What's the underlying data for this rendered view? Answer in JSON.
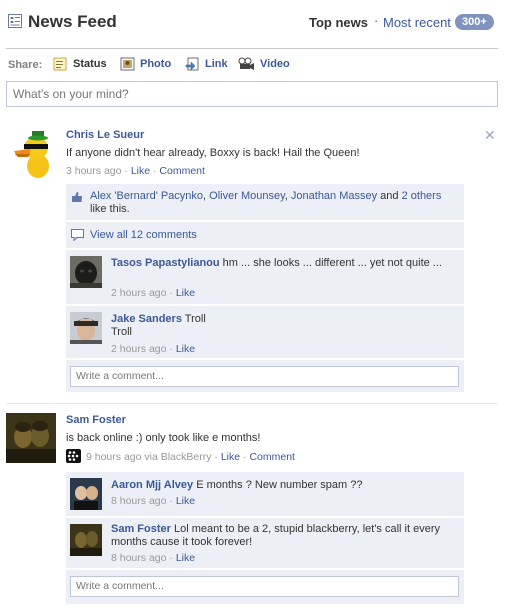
{
  "header": {
    "title": "News Feed",
    "top_news": "Top news",
    "dot": "·",
    "most_recent": "Most recent",
    "badge": "300+"
  },
  "share": {
    "label": "Share:",
    "status": "Status",
    "photo": "Photo",
    "link": "Link",
    "video": "Video",
    "placeholder": "What's on your mind?"
  },
  "story1": {
    "author": "Chris Le Sueur",
    "message": "If anyone didn't hear already, Boxxy is back! Hail the Queen!",
    "time": "3 hours ago",
    "sep": "·",
    "like": "Like",
    "comment": "Comment",
    "likes": {
      "name1": "Alex 'Bernard' Pacynko",
      "comma1": ", ",
      "name2": "Oliver Mounsey",
      "comma2": ", ",
      "name3": "Jonathan Massey",
      "and": " and ",
      "others": "2 others",
      "suffix": " like this."
    },
    "view_all": "View all 12 comments",
    "comments": [
      {
        "author": "Tasos Papastylianou",
        "text": "hm ... she looks ... different ... yet not quite ...",
        "time": "2 hours ago",
        "like": "Like"
      },
      {
        "author": "Jake Sanders",
        "text": "Troll",
        "text2": "Troll",
        "time": "2 hours ago",
        "like": "Like"
      }
    ],
    "write_comment": "Write a comment..."
  },
  "story2": {
    "author": "Sam Foster",
    "message": "is back online :) only took like e months!",
    "time": "9 hours ago via BlackBerry",
    "like": "Like",
    "comment": "Comment",
    "comments": [
      {
        "author": "Aaron Mjj Alvey",
        "text": "E months ? New number spam ??",
        "time": "8 hours ago",
        "like": "Like"
      },
      {
        "author": "Sam Foster",
        "text": "Lol meant to be a 2, stupid blackberry, let's call it every",
        "text2": "months cause it took forever!",
        "time": "8 hours ago",
        "like": "Like"
      }
    ],
    "write_comment": "Write a comment..."
  },
  "colors": {
    "link": "#3b5998",
    "ufi_bg": "#eceff5",
    "badge_bg": "#7f93bc"
  }
}
